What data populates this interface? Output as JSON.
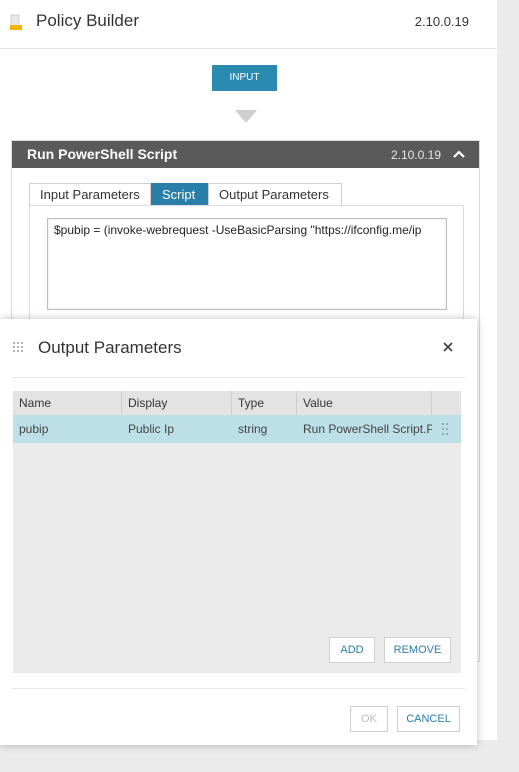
{
  "header": {
    "title": "Policy Builder",
    "version": "2.10.0.19"
  },
  "flow": {
    "input_label": "INPUT"
  },
  "step": {
    "title": "Run PowerShell Script",
    "version": "2.10.0.19",
    "tabs": [
      "Input Parameters",
      "Script",
      "Output Parameters"
    ],
    "active_tab": "Script",
    "script_text": "$pubip = (invoke-webrequest -UseBasicParsing \"https://ifconfig.me/ip"
  },
  "modal": {
    "title": "Output Parameters",
    "columns": [
      "Name",
      "Display",
      "Type",
      "Value"
    ],
    "rows": [
      {
        "name": "pubip",
        "display": "Public Ip",
        "type": "string",
        "value": "Run PowerShell Script.Pi"
      }
    ],
    "add_label": "ADD",
    "remove_label": "REMOVE",
    "ok_label": "OK",
    "cancel_label": "CANCEL"
  },
  "colors": {
    "accent": "#2a8ab0",
    "selected_row": "#bcdfe8",
    "step_header": "#5a5a5a"
  }
}
